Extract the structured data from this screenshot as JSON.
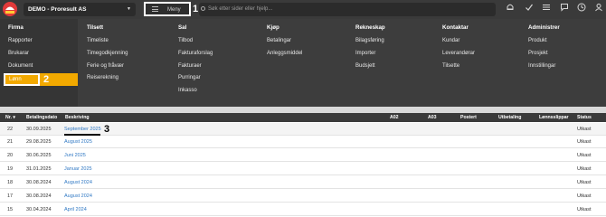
{
  "topbar": {
    "company": "DEMO - Proresult AS",
    "menu_label": "Meny",
    "search_placeholder": "Søk etter sider eller hjelp...",
    "annotations": [
      "1",
      "2",
      "3"
    ]
  },
  "mega_menu": {
    "columns": [
      {
        "title": "Firma",
        "items": [
          "Rapporter",
          "Brukarar",
          "Dokument",
          "Lønn"
        ]
      },
      {
        "title": "Tilsett",
        "items": [
          "Timeliste",
          "Timegodkjenning",
          "Ferie og fråvær",
          "Reiserekning"
        ]
      },
      {
        "title": "Sal",
        "items": [
          "Tilbod",
          "Fakturaforslag",
          "Fakturaer",
          "Purringar",
          "Inkasso"
        ]
      },
      {
        "title": "Kjøp",
        "items": [
          "Betalingar",
          "Anleggsmiddel"
        ]
      },
      {
        "title": "Rekneskap",
        "items": [
          "Bilagsføring",
          "Importer",
          "Budsjett"
        ]
      },
      {
        "title": "Kontaktar",
        "items": [
          "Kundar",
          "Leverandørar",
          "Tilsette"
        ]
      },
      {
        "title": "Administrer",
        "items": [
          "Produkt",
          "Prosjekt",
          "Innstillingar"
        ]
      }
    ]
  },
  "table": {
    "headers": [
      "Nr.",
      "Betalingsdato",
      "Beskriving",
      "A02",
      "A03",
      "Postert",
      "Utbetaling",
      "Lønnsslippar",
      "Status"
    ],
    "rows": [
      {
        "nr": "22",
        "date": "30.09.2025",
        "desc": "September 2025",
        "status": "Utkast"
      },
      {
        "nr": "21",
        "date": "29.08.2025",
        "desc": "August 2025",
        "status": "Utkast"
      },
      {
        "nr": "20",
        "date": "30.06.2025",
        "desc": "Juni 2025",
        "status": "Utkast"
      },
      {
        "nr": "19",
        "date": "31.01.2025",
        "desc": "Januar 2025",
        "status": "Utkast"
      },
      {
        "nr": "18",
        "date": "30.08.2024",
        "desc": "August 2024",
        "status": "Utkast"
      },
      {
        "nr": "17",
        "date": "30.08.2024",
        "desc": "August 2024",
        "status": "Utkast"
      },
      {
        "nr": "15",
        "date": "30.04.2024",
        "desc": "April 2024",
        "status": "Utkast"
      }
    ]
  },
  "icons": [
    "bell-icon",
    "check-icon",
    "list-icon",
    "chat-icon",
    "clock-icon",
    "user-icon"
  ],
  "colors": {
    "accent": "#f2a900",
    "link": "#2f78c4",
    "bar": "#3a3a3a"
  }
}
